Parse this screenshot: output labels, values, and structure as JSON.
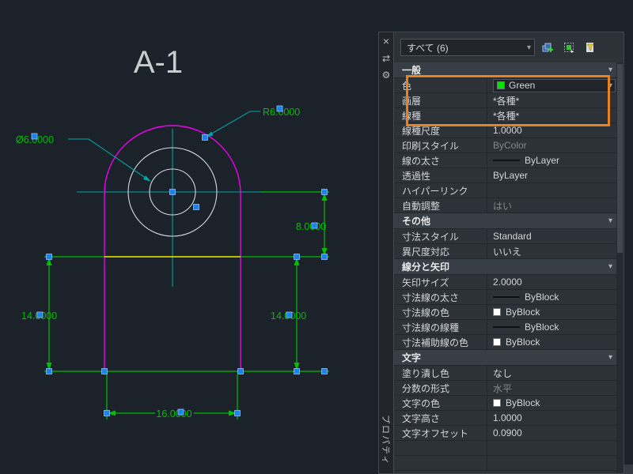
{
  "canvas": {
    "title": "A-1",
    "dimensions": {
      "radius": "R6.0000",
      "diameter": "Ø6.0000",
      "height": "8.0000",
      "left_height": "14.0000",
      "right_height": "14.0000",
      "width": "16.0000"
    }
  },
  "panel": {
    "title": "プロパティ",
    "selector_value": "すべて (6)",
    "icons": {
      "close": "×",
      "auto_hide": "⇄",
      "gear": "⚙",
      "combo_arrow": "▾",
      "section_chevron": "▾"
    },
    "sections": [
      {
        "title": "一般",
        "rows": [
          {
            "label": "色",
            "value": "Green",
            "type": "color-combo",
            "swatch": "#00E400"
          },
          {
            "label": "画層",
            "value": "*各種*"
          },
          {
            "label": "線種",
            "value": "*各種*"
          },
          {
            "label": "線種尺度",
            "value": "1.0000"
          },
          {
            "label": "印刷スタイル",
            "value": "ByColor",
            "muted": true
          },
          {
            "label": "線の太さ",
            "value": "ByLayer",
            "type": "lineweight"
          },
          {
            "label": "透過性",
            "value": "ByLayer"
          },
          {
            "label": "ハイパーリンク",
            "value": ""
          },
          {
            "label": "自動調整",
            "value": "はい",
            "muted": true
          }
        ]
      },
      {
        "title": "その他",
        "rows": [
          {
            "label": "寸法スタイル",
            "value": "Standard"
          },
          {
            "label": "異尺度対応",
            "value": "いいえ"
          }
        ]
      },
      {
        "title": "線分と矢印",
        "rows": [
          {
            "label": "矢印サイズ",
            "value": "2.0000"
          },
          {
            "label": "寸法線の太さ",
            "value": "ByBlock",
            "type": "lineweight"
          },
          {
            "label": "寸法線の色",
            "value": "ByBlock",
            "type": "swatch",
            "swatch": "#FFFFFF"
          },
          {
            "label": "寸法線の線種",
            "value": "ByBlock",
            "type": "lineweight"
          },
          {
            "label": "寸法補助線の色",
            "value": "ByBlock",
            "type": "swatch",
            "swatch": "#FFFFFF"
          }
        ]
      },
      {
        "title": "文字",
        "rows": [
          {
            "label": "塗り潰し色",
            "value": "なし"
          },
          {
            "label": "分数の形式",
            "value": "水平",
            "muted": true
          },
          {
            "label": "文字の色",
            "value": "ByBlock",
            "type": "swatch",
            "swatch": "#FFFFFF"
          },
          {
            "label": "文字高さ",
            "value": "1.0000"
          },
          {
            "label": "文字オフセット",
            "value": "0.0900"
          }
        ]
      }
    ]
  },
  "colors": {
    "bg": "#1B222A",
    "panel_bg": "#2D3238",
    "strip_bg": "#22262B",
    "section_header_bg": "#383E45",
    "border": "#42484F",
    "row_divider": "#23272C",
    "text": "#D2D5D8",
    "muted_text": "#84888D",
    "combo_bg": "#21252A",
    "combo_border": "#4D545C",
    "highlight_orange": "#E8821E",
    "magenta": "#F000F0",
    "yellow": "#F0F000",
    "teal": "#00A5A5",
    "dim_green": "#00C000",
    "circle_gray": "#D5D8DA",
    "grip_fill": "#1E82E8",
    "grip_stroke": "#8CC0FF",
    "title_gray": "#C9CCCF",
    "swatch_green": "#00E400",
    "swatch_white": "#FFFFFF",
    "lineweight": "#0E1114",
    "scroll_track": "#262B31",
    "scroll_thumb": "#41474E"
  }
}
